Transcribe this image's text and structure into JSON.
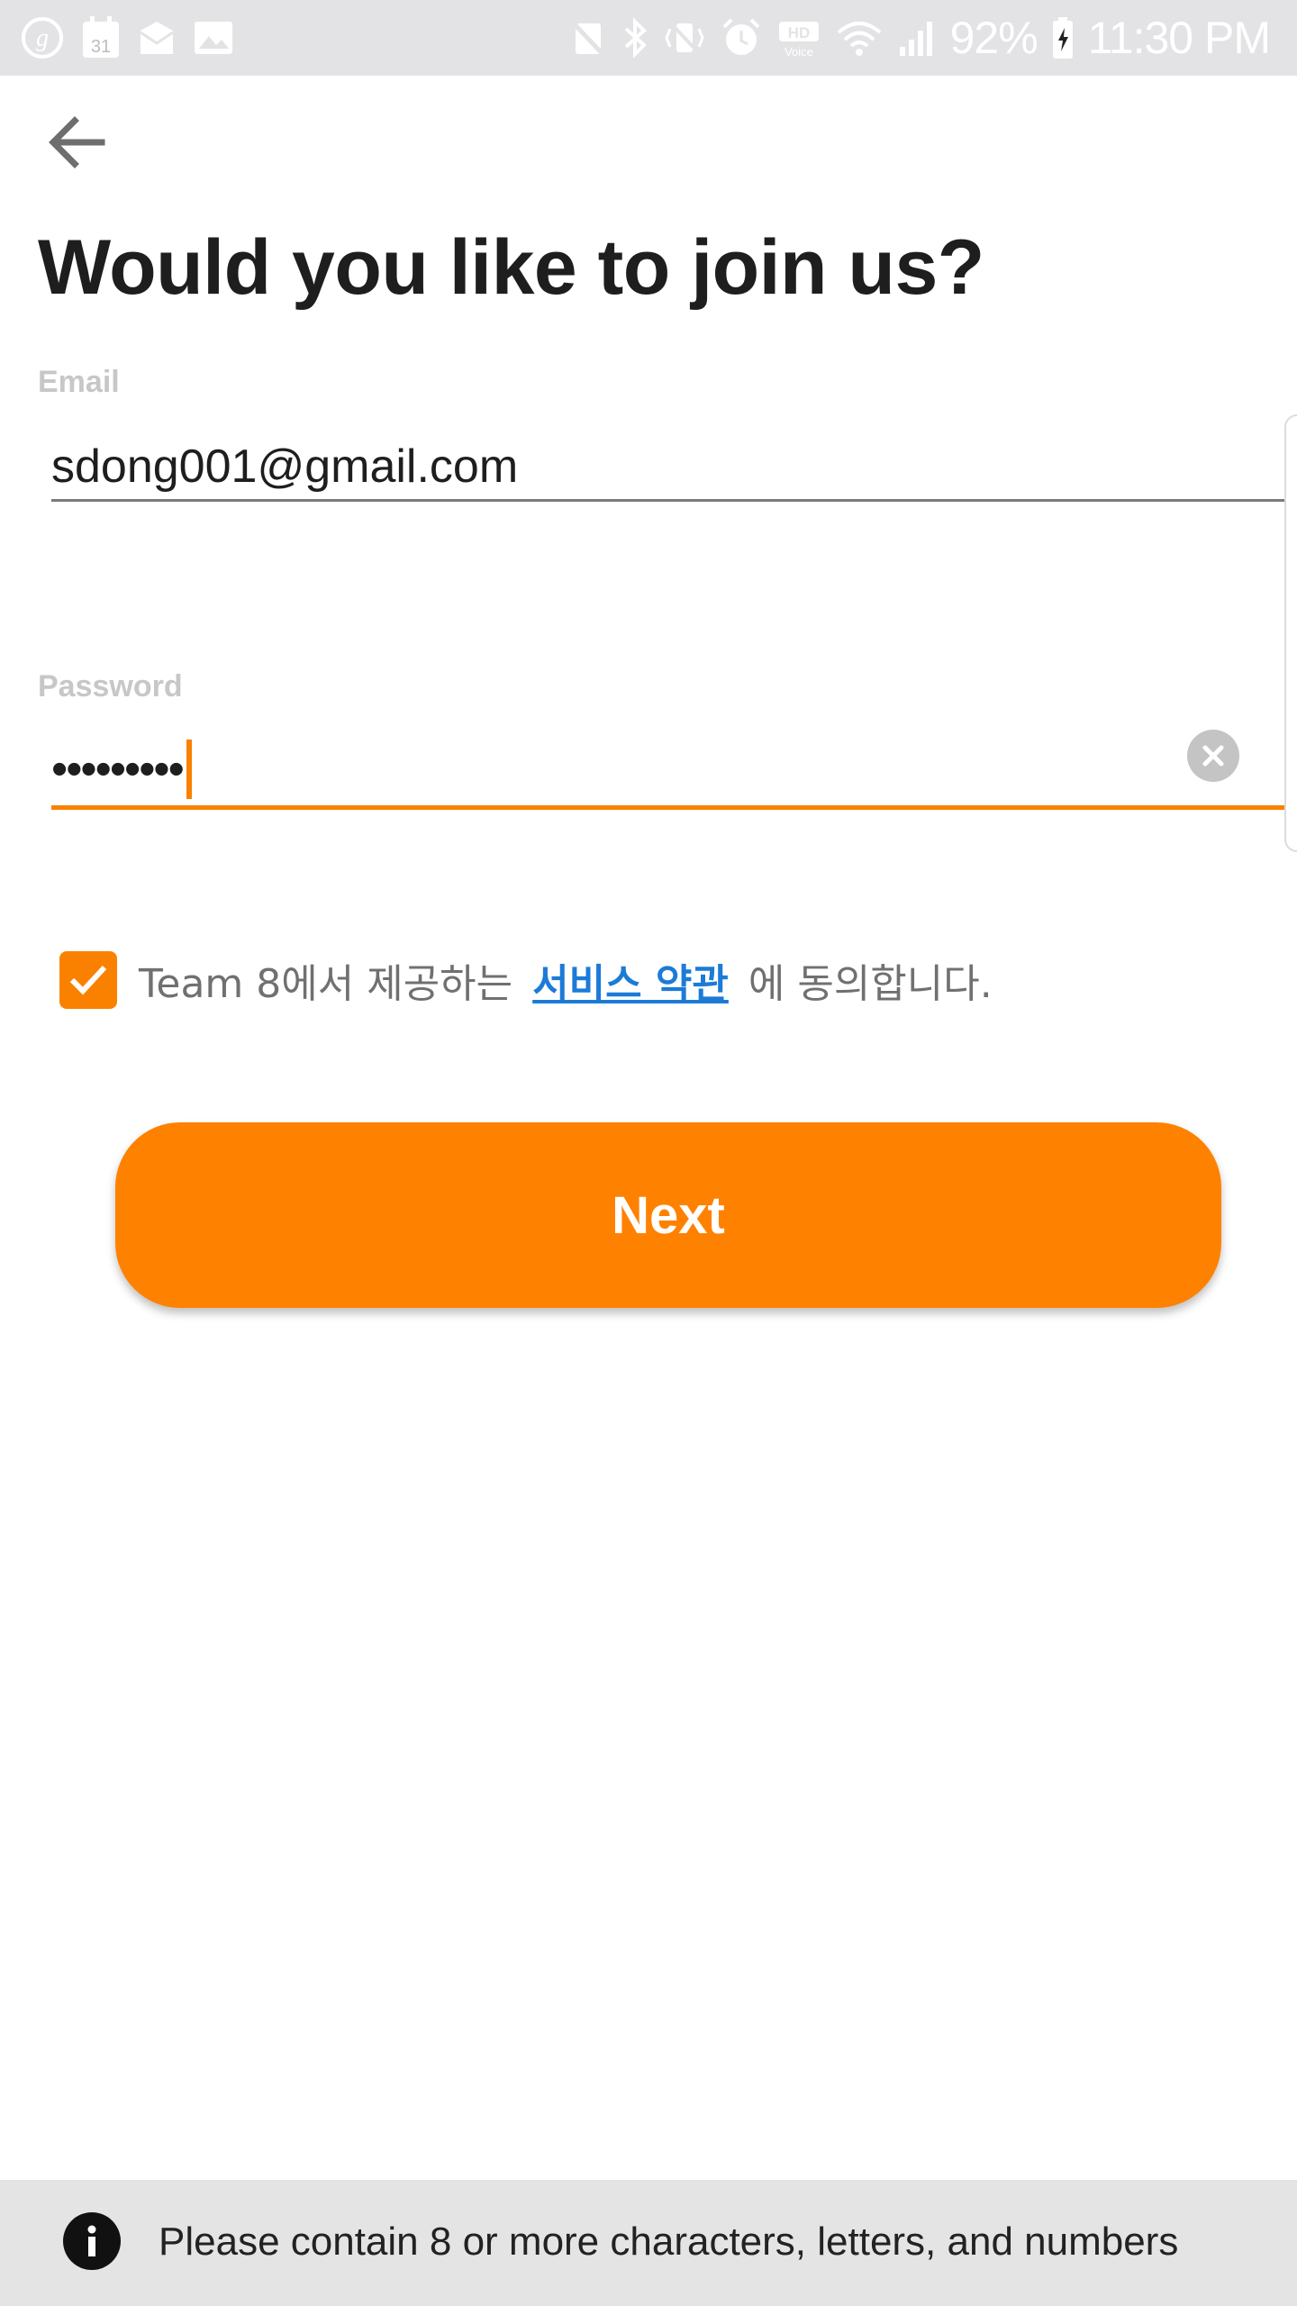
{
  "status_bar": {
    "battery": "92%",
    "time": "11:30 PM",
    "left_icons": [
      "g-icon",
      "calendar-icon",
      "mail-icon",
      "gallery-icon"
    ],
    "calendar_day": "31",
    "right_icons": [
      "nfc-off-icon",
      "bluetooth-icon",
      "vibrate-icon",
      "alarm-icon",
      "hd-voice-icon",
      "wifi-icon",
      "signal-icon",
      "battery-charging-icon"
    ]
  },
  "header": {
    "back_icon": "arrow-left-icon",
    "title": "Would you like to join us?"
  },
  "form": {
    "email": {
      "label": "Email",
      "value": "sdong001@gmail.com"
    },
    "password": {
      "label": "Password",
      "value": "•••••••••",
      "clear_icon": "clear-circle-icon"
    }
  },
  "terms": {
    "checked": true,
    "prefix": "Team 8에서 제공하는",
    "link": "서비스 약관",
    "suffix": "에 동의합니다."
  },
  "actions": {
    "next_label": "Next"
  },
  "info": {
    "icon": "info-icon",
    "message": "Please contain 8 or more characters, letters, and numbers"
  },
  "colors": {
    "accent": "#ff8100",
    "link": "#1c7bd6",
    "status_bar_bg": "#e3e3e5",
    "info_bar_bg": "#e4e4e4"
  }
}
